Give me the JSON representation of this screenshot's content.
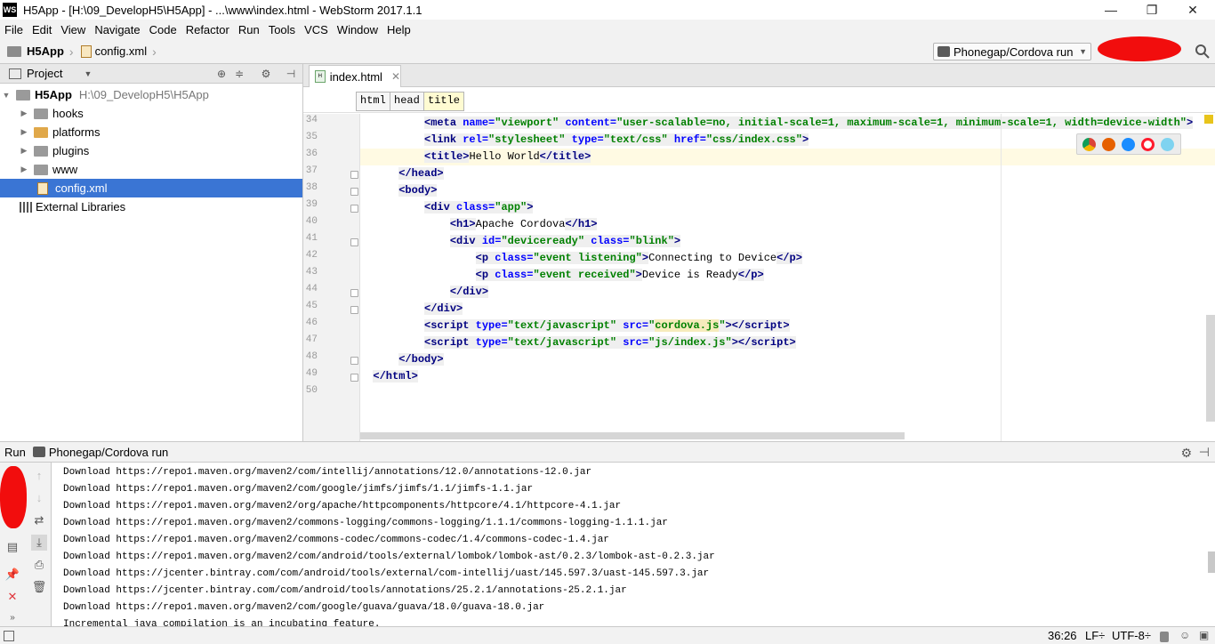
{
  "window": {
    "app_icon_text": "WS",
    "title": "H5App - [H:\\09_DevelopH5\\H5App] - ...\\www\\index.html - WebStorm 2017.1.1",
    "minimize": "—",
    "restore": "❐",
    "close": "✕"
  },
  "menu": [
    "File",
    "Edit",
    "View",
    "Navigate",
    "Code",
    "Refactor",
    "Run",
    "Tools",
    "VCS",
    "Window",
    "Help"
  ],
  "navbar": {
    "project": "H5App",
    "file": "config.xml",
    "run_config": "Phonegap/Cordova run"
  },
  "project_panel": {
    "title": "Project",
    "root": {
      "label": "H5App",
      "path": "H:\\09_DevelopH5\\H5App"
    },
    "items": [
      {
        "label": "hooks"
      },
      {
        "label": "platforms"
      },
      {
        "label": "plugins"
      },
      {
        "label": "www"
      },
      {
        "label": "config.xml"
      },
      {
        "label": "External Libraries"
      }
    ]
  },
  "editor": {
    "tab": "index.html",
    "breadcrumbs": [
      "html",
      "head",
      "title"
    ],
    "line_numbers": [
      "34",
      "35",
      "36",
      "37",
      "38",
      "39",
      "40",
      "41",
      "42",
      "43",
      "44",
      "45",
      "46",
      "47",
      "48",
      "49",
      "50"
    ]
  },
  "run_panel": {
    "label": "Run",
    "config": "Phonegap/Cordova run",
    "lines": [
      "Download https://repo1.maven.org/maven2/com/intellij/annotations/12.0/annotations-12.0.jar",
      "Download https://repo1.maven.org/maven2/com/google/jimfs/jimfs/1.1/jimfs-1.1.jar",
      "Download https://repo1.maven.org/maven2/org/apache/httpcomponents/httpcore/4.1/httpcore-4.1.jar",
      "Download https://repo1.maven.org/maven2/commons-logging/commons-logging/1.1.1/commons-logging-1.1.1.jar",
      "Download https://repo1.maven.org/maven2/commons-codec/commons-codec/1.4/commons-codec-1.4.jar",
      "Download https://repo1.maven.org/maven2/com/android/tools/external/lombok/lombok-ast/0.2.3/lombok-ast-0.2.3.jar",
      "Download https://jcenter.bintray.com/com/android/tools/external/com-intellij/uast/145.597.3/uast-145.597.3.jar",
      "Download https://jcenter.bintray.com/com/android/tools/annotations/25.2.1/annotations-25.2.1.jar",
      "Download https://repo1.maven.org/maven2/com/google/guava/guava/18.0/guava-18.0.jar",
      "Incremental java compilation is an incubating feature."
    ]
  },
  "status": {
    "position": "36:26",
    "line_sep": "LF÷",
    "encoding": "UTF-8÷"
  }
}
